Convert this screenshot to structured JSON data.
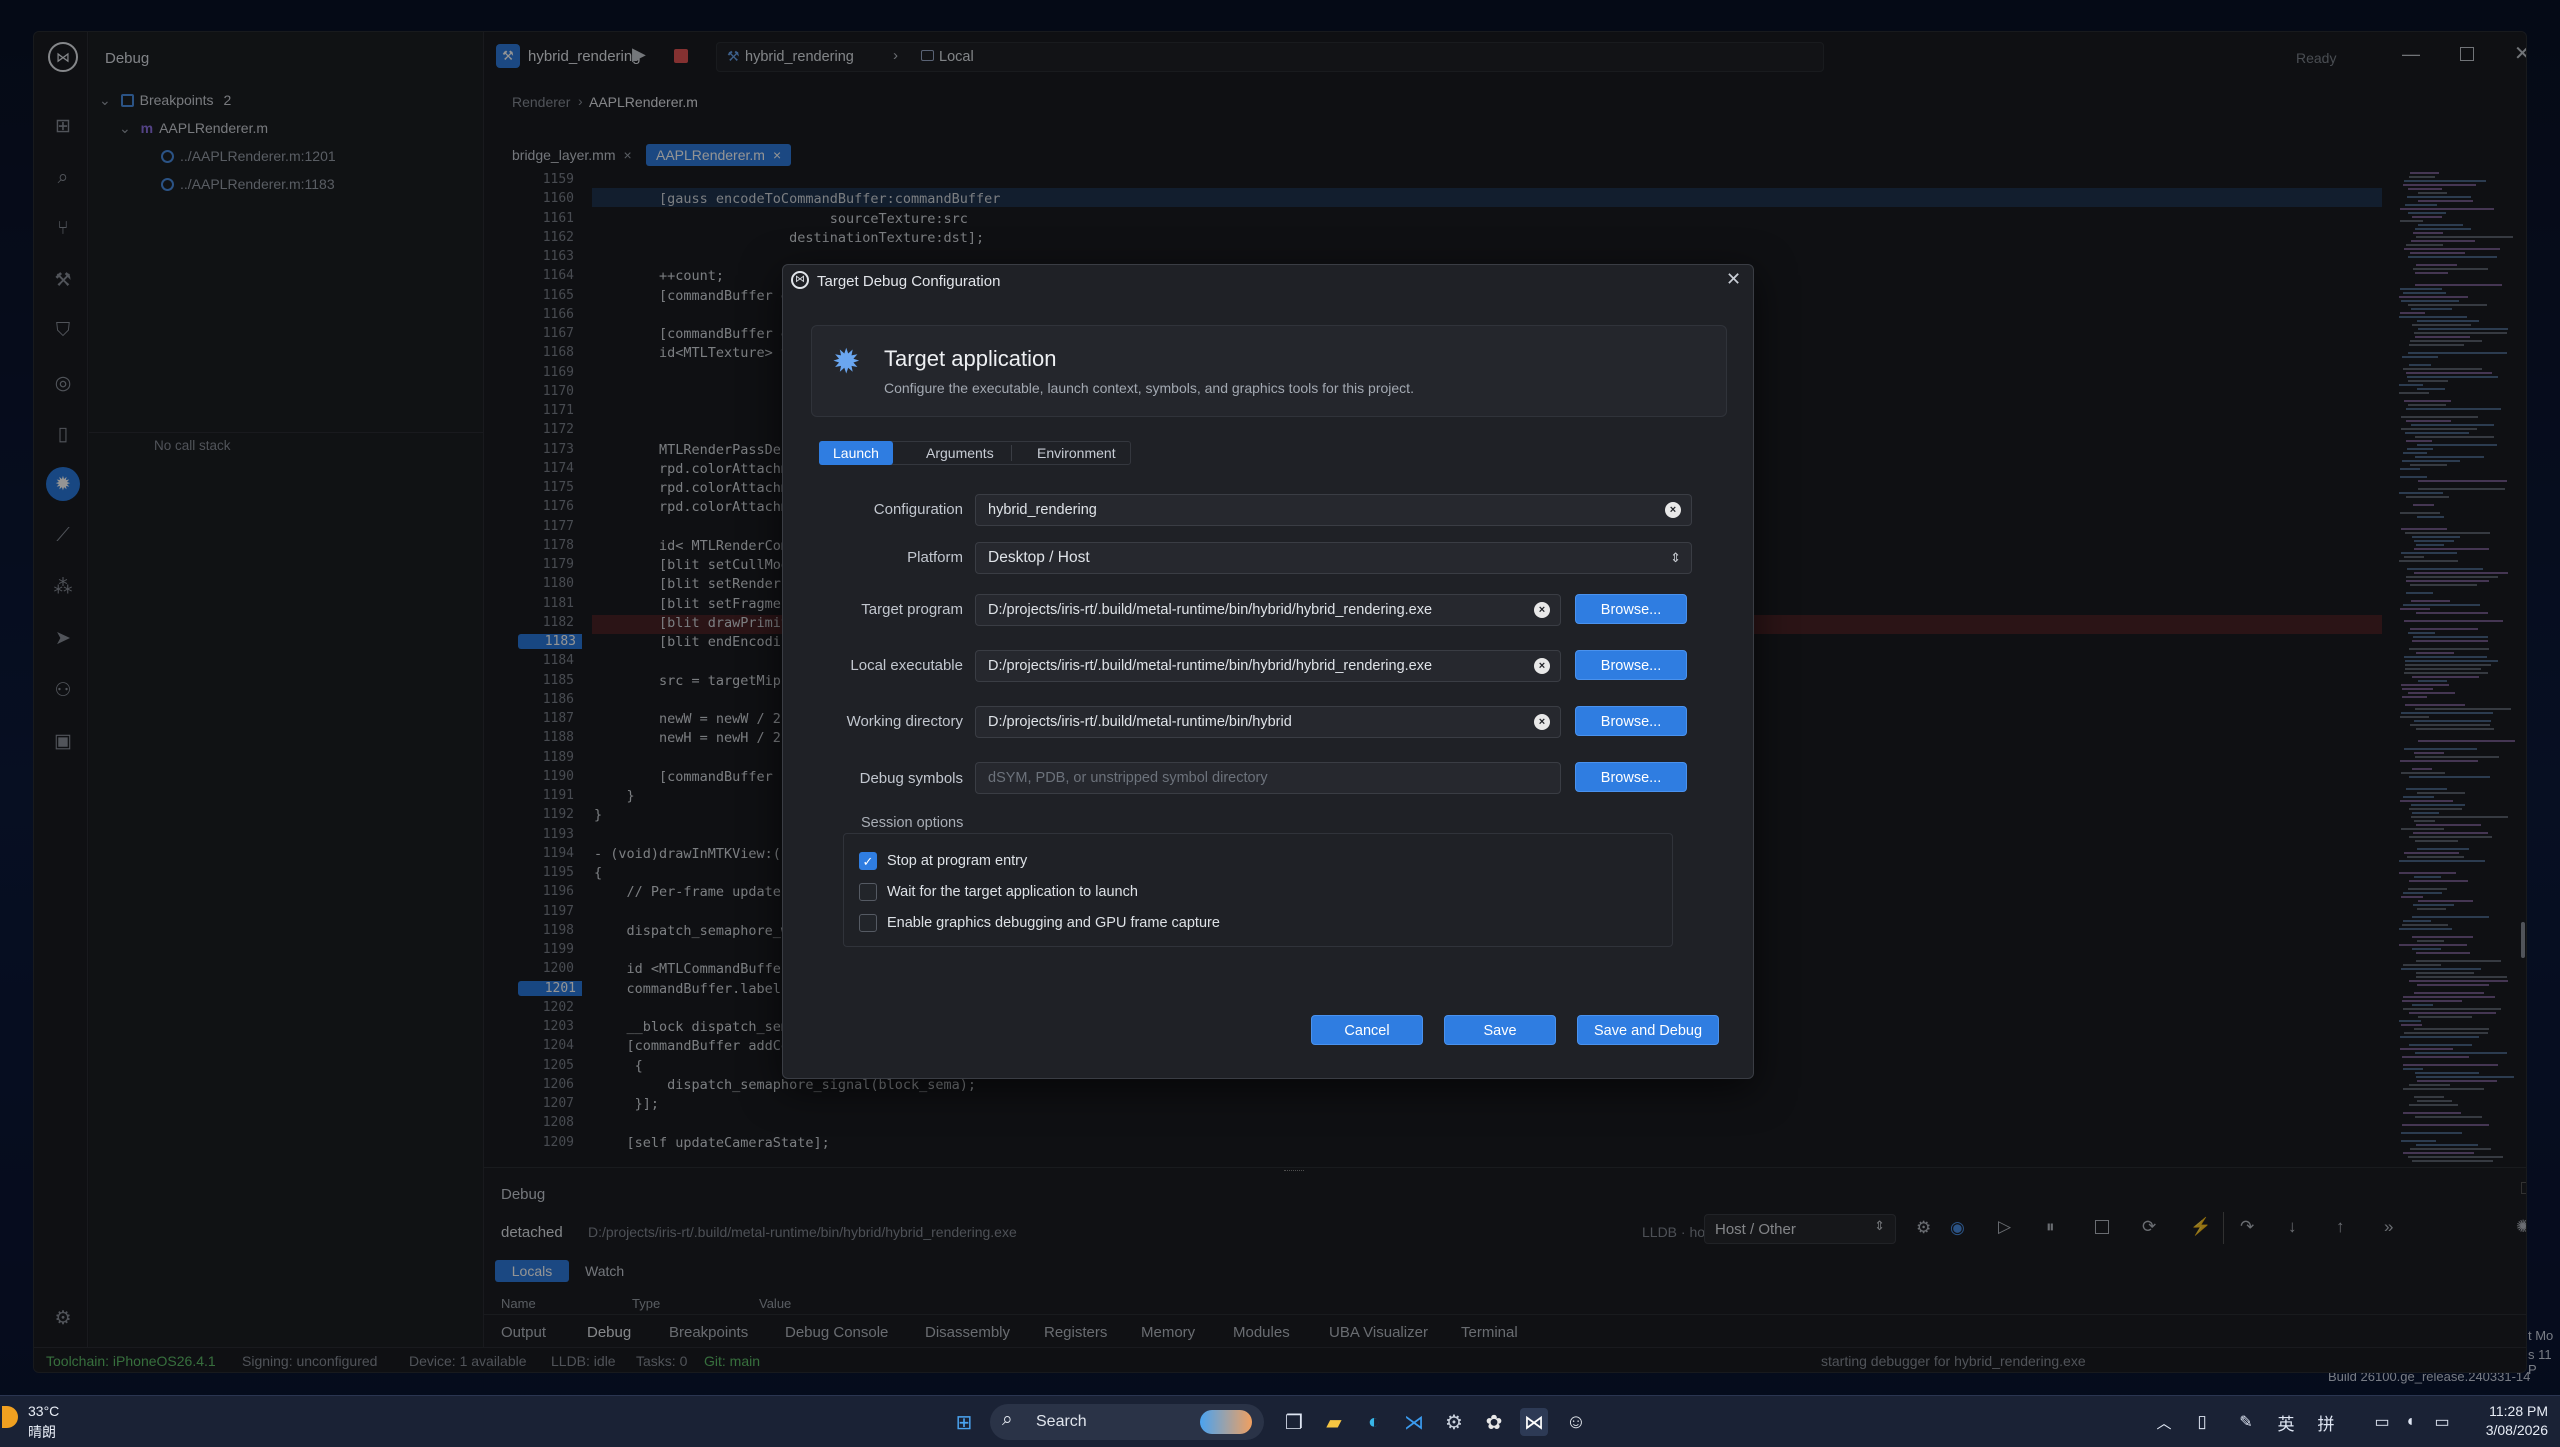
{
  "app": {
    "panel_title": "Debug",
    "window_ready": "Ready"
  },
  "sidebar": {
    "breakpoints_label": "Breakpoints",
    "breakpoints_count": "2",
    "file": "AAPLRenderer.m",
    "bp1": "../AAPLRenderer.m:1201",
    "bp2": "../AAPLRenderer.m:1183",
    "no_call_stack": "No call stack"
  },
  "topbar": {
    "project": "hybrid_rendering",
    "target": "hybrid_rendering",
    "location": "Local"
  },
  "breadcrumb": {
    "parent": "Renderer",
    "file": "AAPLRenderer.m"
  },
  "tabs": [
    {
      "label": "bridge_layer.mm"
    },
    {
      "label": "AAPLRenderer.m"
    }
  ],
  "editor": {
    "lines": [
      {
        "n": "1159",
        "c": ""
      },
      {
        "n": "1160",
        "c": "        [gauss encodeToCommandBuffer:commandBuffer"
      },
      {
        "n": "1161",
        "c": "                             sourceTexture:src"
      },
      {
        "n": "1162",
        "c": "                        destinationTexture:dst];"
      },
      {
        "n": "1163",
        "c": ""
      },
      {
        "n": "1164",
        "c": "        ++count;"
      },
      {
        "n": "1165",
        "c": "        [commandBuffer enc"
      },
      {
        "n": "1166",
        "c": ""
      },
      {
        "n": "1167",
        "c": "        [commandBuffer enc"
      },
      {
        "n": "1168",
        "c": "        id<MTLTexture> targ"
      },
      {
        "n": "1169",
        "c": ""
      },
      {
        "n": "1170",
        "c": ""
      },
      {
        "n": "1171",
        "c": ""
      },
      {
        "n": "1172",
        "c": ""
      },
      {
        "n": "1173",
        "c": "        MTLRenderPassDescri"
      },
      {
        "n": "1174",
        "c": "        rpd.colorAttachment"
      },
      {
        "n": "1175",
        "c": "        rpd.colorAttachment"
      },
      {
        "n": "1176",
        "c": "        rpd.colorAttachment"
      },
      {
        "n": "1177",
        "c": ""
      },
      {
        "n": "1178",
        "c": "        id< MTLRenderComman"
      },
      {
        "n": "1179",
        "c": "        [blit setCullMode:M"
      },
      {
        "n": "1180",
        "c": "        [blit setRenderPipe"
      },
      {
        "n": "1181",
        "c": "        [blit setFragmentTe"
      },
      {
        "n": "1182",
        "c": "        [blit drawPrimitive"
      },
      {
        "n": "1183",
        "c": "        [blit endEncoding];"
      },
      {
        "n": "1184",
        "c": ""
      },
      {
        "n": "1185",
        "c": "        src = targetMip;"
      },
      {
        "n": "1186",
        "c": ""
      },
      {
        "n": "1187",
        "c": "        newW = newW / 2;"
      },
      {
        "n": "1188",
        "c": "        newH = newH / 2;"
      },
      {
        "n": "1189",
        "c": ""
      },
      {
        "n": "1190",
        "c": "        [commandBuffer popD"
      },
      {
        "n": "1191",
        "c": "    }"
      },
      {
        "n": "1192",
        "c": "}"
      },
      {
        "n": "1193",
        "c": ""
      },
      {
        "n": "1194",
        "c": "- (void)drawInMTKView:(nonn"
      },
      {
        "n": "1195",
        "c": "{"
      },
      {
        "n": "1196",
        "c": "    // Per-frame updates he"
      },
      {
        "n": "1197",
        "c": ""
      },
      {
        "n": "1198",
        "c": "    dispatch_semaphore_wait"
      },
      {
        "n": "1199",
        "c": ""
      },
      {
        "n": "1200",
        "c": "    id <MTLCommandBuffer> c"
      },
      {
        "n": "1201",
        "c": "    commandBuffer.label = @"
      },
      {
        "n": "1202",
        "c": ""
      },
      {
        "n": "1203",
        "c": "    __block dispatch_semaph"
      },
      {
        "n": "1204",
        "c": "    [commandBuffer addCompl"
      },
      {
        "n": "1205",
        "c": "     {"
      },
      {
        "n": "1206",
        "c": "         dispatch_semaphore_signal(block_sema);"
      },
      {
        "n": "1207",
        "c": "     }];"
      },
      {
        "n": "1208",
        "c": ""
      },
      {
        "n": "1209",
        "c": "    [self updateCameraState];"
      }
    ]
  },
  "dialog": {
    "title": "Target Debug Configuration",
    "heading": "Target application",
    "subheading": "Configure the executable, launch context, symbols, and graphics tools for this project.",
    "tabs": [
      "Launch",
      "Arguments",
      "Environment"
    ],
    "fields": {
      "configuration_label": "Configuration",
      "configuration_value": "hybrid_rendering",
      "platform_label": "Platform",
      "platform_value": "Desktop / Host",
      "target_label": "Target program",
      "target_value": "D:/projects/iris-rt/.build/metal-runtime/bin/hybrid/hybrid_rendering.exe",
      "local_label": "Local executable",
      "local_value": "D:/projects/iris-rt/.build/metal-runtime/bin/hybrid/hybrid_rendering.exe",
      "workdir_label": "Working directory",
      "workdir_value": "D:/projects/iris-rt/.build/metal-runtime/bin/hybrid",
      "symbols_label": "Debug symbols",
      "symbols_placeholder": "dSYM, PDB, or unstripped symbol directory",
      "browse": "Browse..."
    },
    "session_label": "Session options",
    "options": [
      {
        "label": "Stop at program entry",
        "checked": true
      },
      {
        "label": "Wait for the target application to launch",
        "checked": false
      },
      {
        "label": "Enable graphics debugging and GPU frame capture",
        "checked": false
      }
    ],
    "cancel": "Cancel",
    "save": "Save",
    "save_debug": "Save and Debug"
  },
  "debug_panel": {
    "title": "Debug",
    "state": "detached",
    "path": "D:/projects/iris-rt/.build/metal-runtime/bin/hybrid/hybrid_rendering.exe",
    "lldb": "LLDB · host",
    "host_select": "Host / Other",
    "tab_locals": "Locals",
    "tab_watch": "Watch",
    "col_name": "Name",
    "col_type": "Type",
    "col_value": "Value"
  },
  "panel_tabs": [
    "Output",
    "Debug",
    "Breakpoints",
    "Debug Console",
    "Disassembly",
    "Registers",
    "Memory",
    "Modules",
    "UBA Visualizer",
    "Terminal"
  ],
  "status": {
    "toolchain": "Toolchain: iPhoneOS26.4.1",
    "signing": "Signing: unconfigured",
    "device": "Device: 1 available",
    "lldb": "LLDB: idle",
    "tasks": "Tasks: 0",
    "git": "Git: main",
    "message": "starting debugger for hybrid_rendering.exe"
  },
  "desktop": {
    "build": "Build 26100.ge_release.240331-14",
    "edge1": "t Mo",
    "edge2": "s 11 P"
  },
  "taskbar": {
    "temp": "33°C",
    "weather": "晴朗",
    "search": "Search",
    "lang": "英",
    "ime": "拼",
    "time": "11:28 PM",
    "date": "3/08/2026"
  },
  "colors": {
    "accent": "#2f7de1",
    "breakpoint": "#2a7be0"
  }
}
